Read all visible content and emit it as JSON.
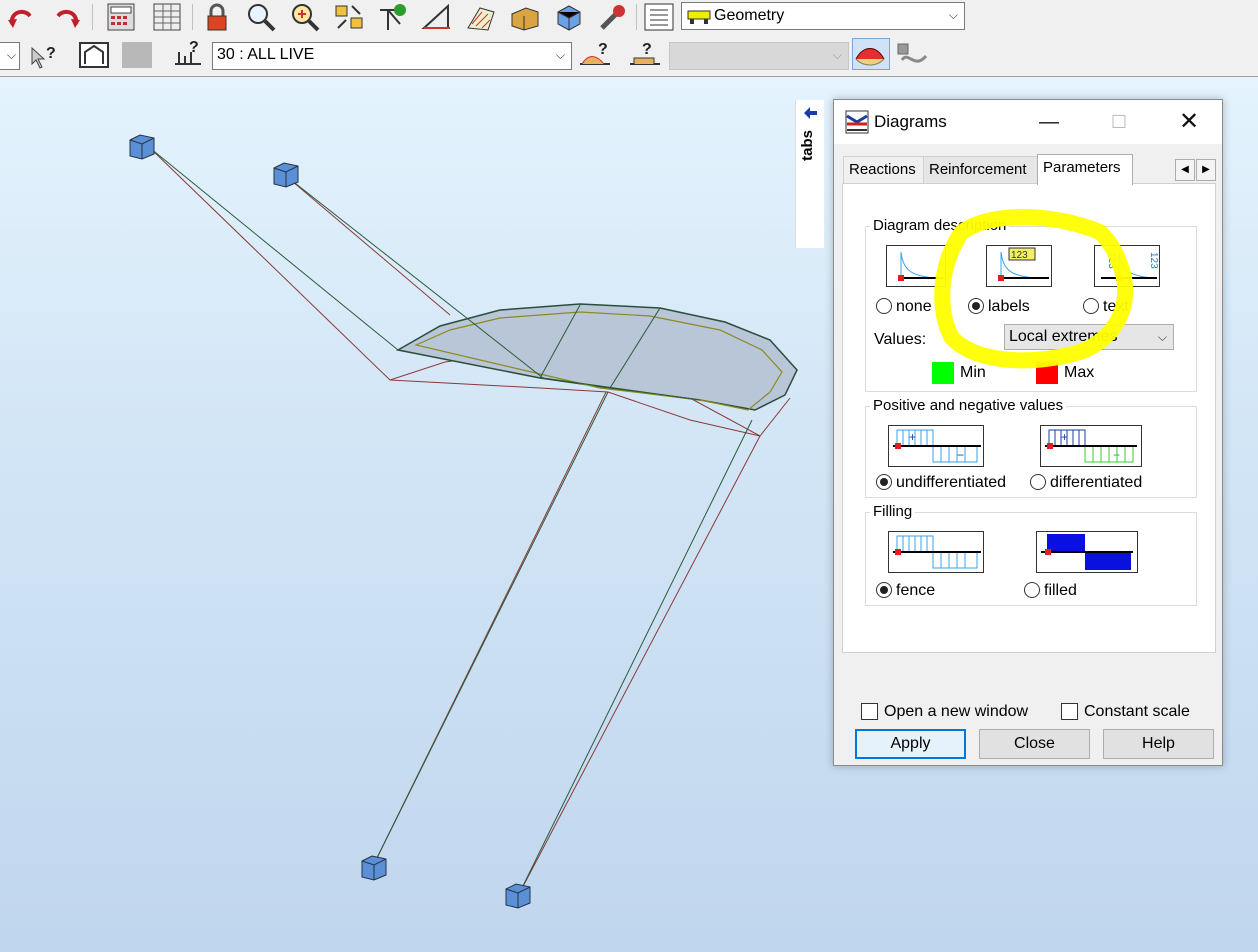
{
  "toolbar1": {
    "view_combo": {
      "value": "Geometry"
    },
    "icons": [
      "undo-icon",
      "redo-icon",
      "calculator-icon",
      "table-icon",
      "lock-icon",
      "zoom-icon",
      "zoom-window-icon",
      "snap-settings-icon",
      "structure-axis-icon",
      "measure-icon",
      "hatch-icon",
      "section-icon",
      "3d-box-icon",
      "wrench-icon",
      "layout-icon"
    ]
  },
  "toolbar2": {
    "case_combo": {
      "value": "30 : ALL LIVE"
    },
    "second_combo": {
      "value": ""
    }
  },
  "side_tab": {
    "label": "tabs"
  },
  "dialog": {
    "title": "Diagrams",
    "tabs": [
      {
        "label": "Reactions"
      },
      {
        "label": "Reinforcement"
      },
      {
        "label": "Parameters"
      }
    ],
    "diagram_description": {
      "title": "Diagram description",
      "options": [
        {
          "label": "none",
          "selected": false
        },
        {
          "label": "labels",
          "selected": true
        },
        {
          "label": "text",
          "selected": false
        }
      ],
      "labels_icon_text": "123",
      "text_icon_text": "123",
      "values_label": "Values:",
      "values_select": "Local extremes",
      "min_label": "Min",
      "min_color": "#00ff00",
      "max_label": "Max",
      "max_color": "#ff0000"
    },
    "pos_neg": {
      "title": "Positive and negative values",
      "options": [
        {
          "label": "undifferentiated",
          "selected": true
        },
        {
          "label": "differentiated",
          "selected": false
        }
      ]
    },
    "filling": {
      "title": "Filling",
      "options": [
        {
          "label": "fence",
          "selected": true
        },
        {
          "label": "filled",
          "selected": false
        }
      ]
    },
    "checkboxes": [
      {
        "label": "Open a new window",
        "checked": false
      },
      {
        "label": "Constant scale",
        "checked": false
      }
    ],
    "buttons": {
      "apply": "Apply",
      "close": "Close",
      "help": "Help"
    }
  },
  "colors": {
    "highlight": "#ffff00",
    "node_blue": "#5b8fd6",
    "accent": "#0078d7"
  }
}
